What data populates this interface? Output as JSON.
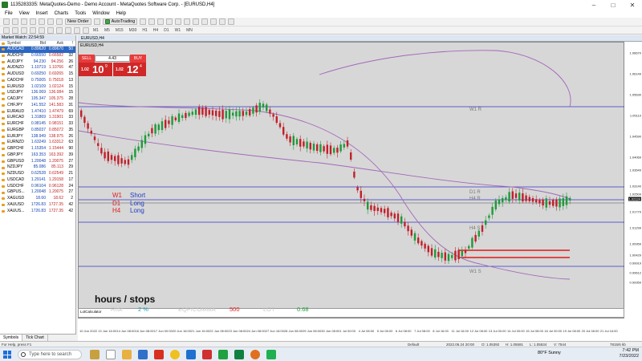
{
  "window": {
    "title": "1135283335: MetaQuotes-Demo - Demo Account - MetaQuotes Software Corp. - [EURUSD,H4]",
    "controls": [
      "–",
      "□",
      "✕"
    ]
  },
  "menu": [
    "File",
    "View",
    "Insert",
    "Charts",
    "Tools",
    "Window",
    "Help"
  ],
  "toolbar": {
    "new_order": "New Order",
    "auto_trading": "AutoTrading"
  },
  "timeframes": [
    "M1",
    "M5",
    "M15",
    "M30",
    "H1",
    "H4",
    "D1",
    "W1",
    "MN"
  ],
  "market_watch": {
    "title": "Market Watch: 22:54:59",
    "columns": [
      "Symbol",
      "Bid",
      "Ask",
      "!"
    ],
    "rows": [
      {
        "symbol": "AUDCAD",
        "bid": "0.89620",
        "ask": "0.89670",
        "spread": "50"
      },
      {
        "symbol": "AUDCHF",
        "bid": "0.66550",
        "ask": "0.66582",
        "spread": "32"
      },
      {
        "symbol": "AUDJPY",
        "bid": "94.230",
        "ask": "94.256",
        "spread": "26"
      },
      {
        "symbol": "AUDNZD",
        "bid": "1.10719",
        "ask": "1.10766",
        "spread": "47"
      },
      {
        "symbol": "AUDUSD",
        "bid": "0.69250",
        "ask": "0.69265",
        "spread": "15"
      },
      {
        "symbol": "CADCHF",
        "bid": "0.75005",
        "ask": "0.75018",
        "spread": "13"
      },
      {
        "symbol": "EURUSD",
        "bid": "1.02109",
        "ask": "1.02124",
        "spread": "15"
      },
      {
        "symbol": "USDJPY",
        "bid": "136.069",
        "ask": "136.084",
        "spread": "15"
      },
      {
        "symbol": "CADJPY",
        "bid": "105.347",
        "ask": "105.375",
        "spread": "28"
      },
      {
        "symbol": "CHFJPY",
        "bid": "141.552",
        "ask": "141.583",
        "spread": "31"
      },
      {
        "symbol": "EURAUD",
        "bid": "1.47410",
        "ask": "1.47479",
        "spread": "69"
      },
      {
        "symbol": "EURCAD",
        "bid": "1.31869",
        "ask": "1.31901",
        "spread": "33"
      },
      {
        "symbol": "EURCHF",
        "bid": "0.98145",
        "ask": "0.98151",
        "spread": "33"
      },
      {
        "symbol": "EURGBP",
        "bid": "0.85037",
        "ask": "0.85072",
        "spread": "35"
      },
      {
        "symbol": "EURJPY",
        "bid": "138.949",
        "ask": "138.975",
        "spread": "26"
      },
      {
        "symbol": "EURNZD",
        "bid": "1.63249",
        "ask": "1.63312",
        "spread": "63"
      },
      {
        "symbol": "GBPCHF",
        "bid": "1.15354",
        "ask": "1.15444",
        "spread": "90"
      },
      {
        "symbol": "GBPJPY",
        "bid": "163.353",
        "ask": "163.392",
        "spread": "39"
      },
      {
        "symbol": "GBPUSD",
        "bid": "1.20048",
        "ask": "1.20075",
        "spread": "27"
      },
      {
        "symbol": "NZDJPY",
        "bid": "85.086",
        "ask": "85.113",
        "spread": "29"
      },
      {
        "symbol": "NZDUSD",
        "bid": "0.62528",
        "ask": "0.62549",
        "spread": "21"
      },
      {
        "symbol": "USDCAD",
        "bid": "1.29141",
        "ask": "1.29158",
        "spread": "17"
      },
      {
        "symbol": "USDCHF",
        "bid": "0.96104",
        "ask": "0.96128",
        "spread": "24"
      },
      {
        "symbol": "GBPUS...",
        "bid": "1.20048",
        "ask": "1.20075",
        "spread": "27"
      },
      {
        "symbol": "XAGUSD",
        "bid": "18.60",
        "ask": "18.62",
        "spread": "2"
      },
      {
        "symbol": "XAUUSD",
        "bid": "1726.83",
        "ask": "1727.35",
        "spread": "42"
      },
      {
        "symbol": "XAUUS...",
        "bid": "1726.83",
        "ask": "1727.35",
        "spread": "42"
      }
    ],
    "tabs": [
      "Symbols",
      "Tick Chart"
    ]
  },
  "chart": {
    "tab": "EURUSD,H4",
    "symbol_label": "EURUSD,H4",
    "trade_panel": {
      "sell": "SELL",
      "buy": "BUY",
      "lot": "4.43",
      "sell_small": "1.02",
      "sell_big": "10",
      "sell_sup": "9",
      "buy_small": "1.02",
      "buy_big": "12",
      "buy_sup": "4"
    },
    "levels": {
      "w1r": "W1 R",
      "d1r": "D1 R",
      "h4r": "H4 R",
      "h4s": "H4 S",
      "w1s": "W1 S"
    },
    "legend": [
      {
        "tf": "W1",
        "dir": "Short"
      },
      {
        "tf": "D1",
        "dir": "Long"
      },
      {
        "tf": "H4",
        "dir": "Long"
      }
    ],
    "note": "hours / stops",
    "lot_calculator": "LotCalculator",
    "info": {
      "risk_label": "Risk",
      "risk_value": "2 %",
      "eq_label": "EQP/COMMA",
      "eq_value": "500",
      "lot_label": "LOT",
      "lot_value": "0.68"
    },
    "price_labels": [
      "1.06670",
      "1.06149",
      "1.05630",
      "1.05110",
      "1.04590",
      "1.04069",
      "1.03549",
      "1.03140",
      "1.02509",
      "1.02124",
      "1.01779",
      "1.01299",
      "1.00959",
      "1.00429",
      "0.99919",
      "0.99612",
      "0.99359"
    ],
    "time_labels": [
      "10 Jun 2022",
      "13 Jun 16:00",
      "14 Jun 08:00",
      "16 Jun 08:00",
      "17 Jun 00:00",
      "20 Jun 16:00",
      "21 Jun 16:00",
      "22 Jun 08:00",
      "23 Jun 08:00",
      "24 Jun 08:00",
      "27 Jun 16:00",
      "28 Jun 08:00",
      "29 Jun 08:00",
      "30 Jun 08:00",
      "1 Jul 00:00",
      "4 Jul 08:00",
      "5 Jul 08:00",
      "6 Jul 08:00",
      "7 Jul 08:00",
      "8 Jul 16:00",
      "11 Jul 16:00",
      "12 Jul 08:00",
      "13 Jul 00:00",
      "14 Jul 00:00",
      "15 Jul 08:00",
      "18 Jul 00:00",
      "19 Jul 08:00",
      "20 Jul 08:00",
      "21 Jul 16:00"
    ]
  },
  "status_bar": {
    "profile": "Default",
    "help": "For Help, press F1",
    "datetime": "2022.06.24 20:00",
    "o": "O: 1.05392",
    "h": "H: 1.05591",
    "l": "L: 1.05534",
    "v": "V: 7544",
    "traffic": "7815/6 kb"
  },
  "taskbar": {
    "search": "Type here to search",
    "weather": "80°F  Sunny",
    "time": "7:42 PM",
    "date": "7/23/2022"
  },
  "colors": {
    "bull": "#1f9a3a",
    "bear": "#c0202a",
    "ma": "#a268b8",
    "level_blue": "#3434c8",
    "level_red": "#e01818"
  }
}
